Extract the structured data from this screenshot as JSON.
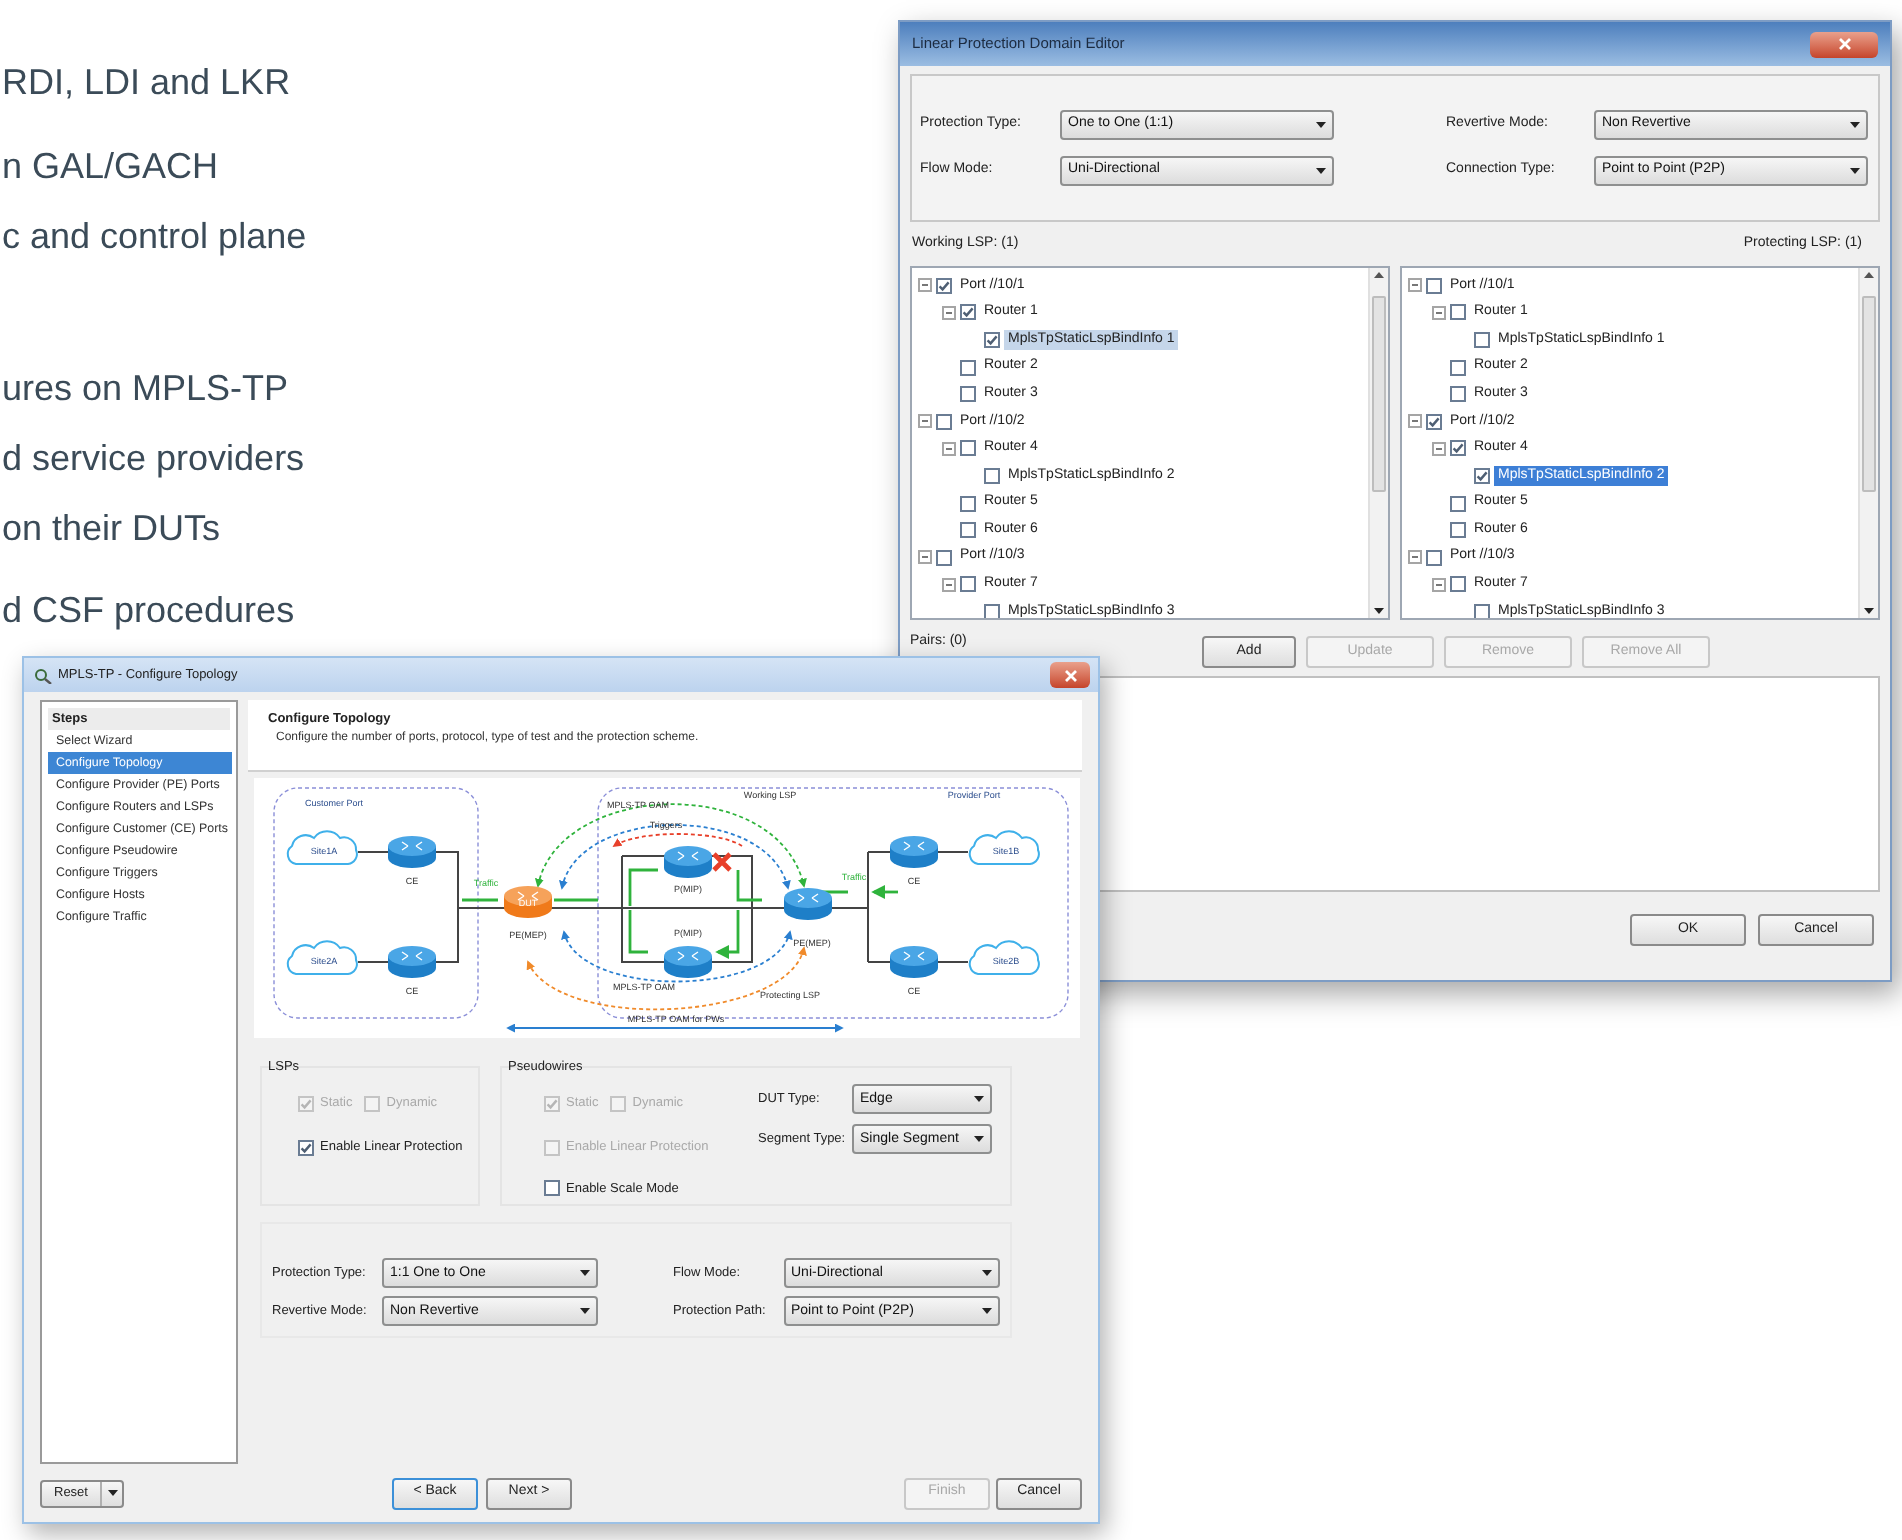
{
  "feature_text": [
    [
      "RDI, LDI and LKR"
    ],
    [
      "n GAL/GACH",
      "c and control plane"
    ],
    [
      "ures on MPLS-TP",
      "d service providers",
      "on their DUTs"
    ],
    [
      "d CSF procedures"
    ]
  ],
  "editor": {
    "title": "Linear Protection Domain Editor",
    "fields": [
      {
        "label": "Protection Type:",
        "value": "One to One (1:1)"
      },
      {
        "label": "Revertive Mode:",
        "value": "Non Revertive"
      },
      {
        "label": "Flow Mode:",
        "value": "Uni-Directional"
      },
      {
        "label": "Connection Type:",
        "value": "Point to Point (P2P)"
      }
    ],
    "working_label": "Working LSP: (1)",
    "protecting_label": "Protecting LSP: (1)",
    "working_tree": [
      {
        "label": "Port //10/1",
        "checked": true,
        "selected": false,
        "expanded": true,
        "children": [
          {
            "label": "Router 1",
            "checked": true,
            "selected": false,
            "expanded": true,
            "children": [
              {
                "label": "MplsTpStaticLspBindInfo 1",
                "checked": true,
                "selected": true
              }
            ]
          },
          {
            "label": "Router 2",
            "checked": false,
            "selected": false
          },
          {
            "label": "Router 3",
            "checked": false,
            "selected": false
          }
        ]
      },
      {
        "label": "Port //10/2",
        "checked": false,
        "selected": false,
        "expanded": true,
        "children": [
          {
            "label": "Router 4",
            "checked": false,
            "selected": false,
            "expanded": true,
            "children": [
              {
                "label": "MplsTpStaticLspBindInfo 2",
                "checked": false,
                "selected": false
              }
            ]
          },
          {
            "label": "Router 5",
            "checked": false,
            "selected": false
          },
          {
            "label": "Router 6",
            "checked": false,
            "selected": false
          }
        ]
      },
      {
        "label": "Port //10/3",
        "checked": false,
        "selected": false,
        "expanded": true,
        "children": [
          {
            "label": "Router 7",
            "checked": false,
            "selected": false,
            "expanded": true,
            "children": [
              {
                "label": "MplsTpStaticLspBindInfo 3",
                "checked": false,
                "selected": false
              }
            ]
          }
        ]
      }
    ],
    "protecting_tree": [
      {
        "label": "Port //10/1",
        "checked": false,
        "selected": false,
        "expanded": true,
        "children": [
          {
            "label": "Router 1",
            "checked": false,
            "selected": false,
            "expanded": true,
            "children": [
              {
                "label": "MplsTpStaticLspBindInfo 1",
                "checked": false,
                "selected": false
              }
            ]
          },
          {
            "label": "Router 2",
            "checked": false,
            "selected": false
          },
          {
            "label": "Router 3",
            "checked": false,
            "selected": false
          }
        ]
      },
      {
        "label": "Port //10/2",
        "checked": true,
        "selected": false,
        "expanded": true,
        "children": [
          {
            "label": "Router 4",
            "checked": true,
            "selected": false,
            "expanded": true,
            "children": [
              {
                "label": "MplsTpStaticLspBindInfo 2",
                "checked": true,
                "selected": true
              }
            ]
          },
          {
            "label": "Router 5",
            "checked": false,
            "selected": false
          },
          {
            "label": "Router 6",
            "checked": false,
            "selected": false
          }
        ]
      },
      {
        "label": "Port //10/3",
        "checked": false,
        "selected": false,
        "expanded": true,
        "children": [
          {
            "label": "Router 7",
            "checked": false,
            "selected": false,
            "expanded": true,
            "children": [
              {
                "label": "MplsTpStaticLspBindInfo 3",
                "checked": false,
                "selected": false
              }
            ]
          }
        ]
      }
    ],
    "pairs_label": "Pairs: (0)",
    "list_buttons": [
      {
        "label": "Add",
        "disabled": false
      },
      {
        "label": "Update",
        "disabled": true
      },
      {
        "label": "Remove",
        "disabled": true
      },
      {
        "label": "Remove All",
        "disabled": true
      }
    ],
    "dialog_buttons": [
      {
        "label": "OK"
      },
      {
        "label": "Cancel"
      }
    ]
  },
  "wizard": {
    "title": "MPLS-TP - Configure Topology",
    "steps_heading": "Steps",
    "steps": [
      {
        "label": "Select Wizard",
        "selected": false
      },
      {
        "label": "Configure Topology",
        "selected": true
      },
      {
        "label": "Configure Provider (PE) Ports",
        "selected": false
      },
      {
        "label": "Configure Routers and LSPs",
        "selected": false
      },
      {
        "label": "Configure Customer (CE) Ports",
        "selected": false
      },
      {
        "label": "Configure Pseudowire",
        "selected": false
      },
      {
        "label": "Configure Triggers",
        "selected": false
      },
      {
        "label": "Configure Hosts",
        "selected": false
      },
      {
        "label": "Configure Traffic",
        "selected": false
      }
    ],
    "header": {
      "title": "Configure Topology",
      "subtitle": "Configure the number of ports, protocol, type of test and the protection scheme."
    },
    "diagram": {
      "customer_port": "Customer Port",
      "provider_port": "Provider Port",
      "sites": [
        "Site1A",
        "Site2A",
        "Site1B",
        "Site2B"
      ],
      "ce_labels": [
        "CE",
        "CE",
        "CE",
        "CE"
      ],
      "dut": "DUT",
      "pe_labels": [
        "PE(MEP)",
        "PE(MEP)"
      ],
      "p_labels": [
        "P(MIP)",
        "P(MIP)"
      ],
      "traffic_labels": [
        "Traffic",
        "Traffic"
      ],
      "oam_labels": [
        "MPLS-TP OAM",
        "MPLS-TP OAM"
      ],
      "triggers": "Triggers",
      "working_lsp": "Working LSP",
      "protecting_lsp": "Protecting LSP",
      "pw_oam": "MPLS-TP OAM for PWs"
    },
    "lsps": {
      "title": "LSPs",
      "options": [
        {
          "label": "Static",
          "checked": true,
          "disabled": true
        },
        {
          "label": "Dynamic",
          "checked": false,
          "disabled": true
        }
      ],
      "linear_protection": {
        "label": "Enable Linear Protection",
        "checked": true,
        "disabled": false
      }
    },
    "pseudowires": {
      "title": "Pseudowires",
      "options": [
        {
          "label": "Static",
          "checked": true,
          "disabled": true
        },
        {
          "label": "Dynamic",
          "checked": false,
          "disabled": true
        }
      ],
      "linear_protection": {
        "label": "Enable Linear Protection",
        "checked": false,
        "disabled": true
      },
      "scale_mode": {
        "label": "Enable Scale Mode",
        "checked": false,
        "disabled": false
      }
    },
    "pw_fields": [
      {
        "label": "DUT Type:",
        "value": "Edge"
      },
      {
        "label": "Segment Type:",
        "value": "Single Segment"
      }
    ],
    "protection_fields": [
      {
        "label": "Protection Type:",
        "value": "1:1 One to One"
      },
      {
        "label": "Flow Mode:",
        "value": "Uni-Directional"
      },
      {
        "label": "Revertive Mode:",
        "value": "Non Revertive"
      },
      {
        "label": "Protection Path:",
        "value": "Point to Point (P2P)"
      }
    ],
    "reset_button": {
      "label": "Reset"
    },
    "nav_buttons": [
      {
        "label": "< Back",
        "disabled": false,
        "default": true
      },
      {
        "label": "Next >",
        "disabled": false,
        "default": false
      }
    ],
    "end_buttons": [
      {
        "label": "Finish",
        "disabled": true
      },
      {
        "label": "Cancel",
        "disabled": false
      }
    ]
  }
}
